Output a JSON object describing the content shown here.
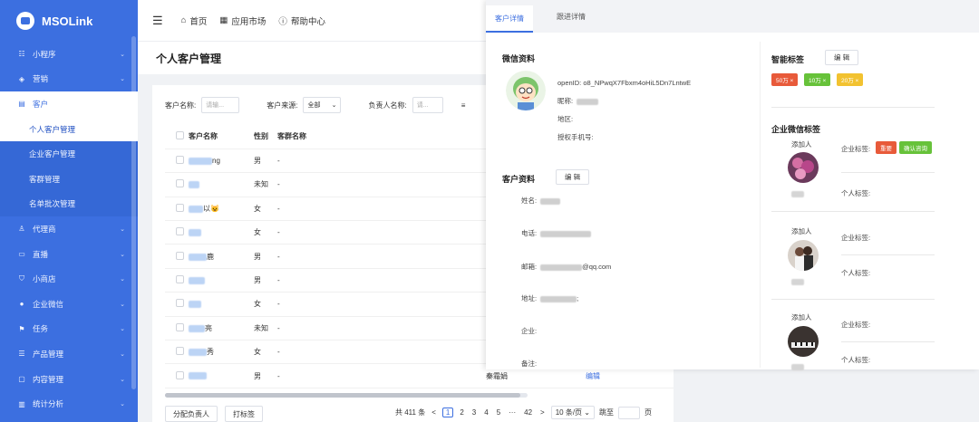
{
  "app": {
    "logo_text": "MSOLink"
  },
  "sidebar": {
    "items": [
      {
        "label": "小程序",
        "icon": "list-icon"
      },
      {
        "label": "营销",
        "icon": "megaphone-icon"
      },
      {
        "label": "客户",
        "icon": "document-icon"
      },
      {
        "label": "代理商",
        "icon": "user-icon"
      },
      {
        "label": "直播",
        "icon": "video-icon"
      },
      {
        "label": "小商店",
        "icon": "cart-icon"
      },
      {
        "label": "企业微信",
        "icon": "wechat-icon"
      },
      {
        "label": "任务",
        "icon": "flag-icon"
      },
      {
        "label": "产品管理",
        "icon": "list-icon"
      },
      {
        "label": "内容管理",
        "icon": "file-icon"
      },
      {
        "label": "统计分析",
        "icon": "chart-icon"
      }
    ],
    "sub_items": [
      {
        "label": "个人客户管理"
      },
      {
        "label": "企业客户管理"
      },
      {
        "label": "客群管理"
      },
      {
        "label": "名单批次管理"
      }
    ]
  },
  "topbar": {
    "home": "首页",
    "market": "应用市场",
    "help": "帮助中心"
  },
  "page": {
    "title": "个人客户管理"
  },
  "filters": {
    "name_label": "客户名称:",
    "name_placeholder": "请输...",
    "source_label": "客户来源:",
    "source_value": "全部",
    "owner_label": "负责人名称:",
    "owner_placeholder": "请...",
    "more": "≡"
  },
  "table": {
    "headers": {
      "name": "客户名称",
      "gender": "性别",
      "wechat": "客群名称"
    },
    "rows": [
      {
        "suffix": "ng",
        "gender": "男",
        "wechat": "-"
      },
      {
        "suffix": "",
        "gender": "未知",
        "wechat": "-"
      },
      {
        "suffix": "以😺",
        "gender": "女",
        "wechat": "-"
      },
      {
        "suffix": "",
        "gender": "女",
        "wechat": "-"
      },
      {
        "suffix": "鹿",
        "gender": "男",
        "wechat": "-"
      },
      {
        "suffix": "",
        "gender": "男",
        "wechat": "-"
      },
      {
        "suffix": "",
        "gender": "女",
        "wechat": "-"
      },
      {
        "suffix": "亮",
        "gender": "未知",
        "wechat": "-"
      },
      {
        "suffix": "秀",
        "gender": "女",
        "wechat": "-"
      },
      {
        "suffix": "",
        "gender": "男",
        "wechat": "-",
        "extra": "秦霜娟",
        "action": "编辑"
      }
    ]
  },
  "footer": {
    "assign_btn": "分配负责人",
    "tag_btn": "打标签",
    "total": "共 411 条",
    "prev": "<",
    "pages": [
      "1",
      "2",
      "3",
      "4",
      "5",
      "···",
      "42"
    ],
    "next": ">",
    "page_size": "10 条/页",
    "jump": "跳至",
    "page_unit": "页"
  },
  "drawer": {
    "tabs": [
      "客户详情",
      "跟进详情"
    ],
    "wechat_profile": {
      "title": "微信资料",
      "openid_label": "openID:",
      "openid": "o8_NPwqX7Fbxm4oHiL5Dn7LntwE",
      "nickname_label": "昵称:",
      "region_label": "地区:",
      "phone_label": "授权手机号:"
    },
    "customer_profile": {
      "title": "客户资料",
      "edit": "编 辑",
      "name_label": "姓名:",
      "phone_label": "电话:",
      "email_label": "邮箱:",
      "email_suffix": "@qq.com",
      "address_label": "地址:",
      "address_suffix": ";",
      "company_label": "企业:",
      "remark_label": "备注:"
    },
    "smart_tags": {
      "title": "智能标签",
      "edit": "编 辑",
      "tags": [
        {
          "label": "50万 ×",
          "color": "#e85a3a"
        },
        {
          "label": "10万 ×",
          "color": "#67c23a"
        },
        {
          "label": "20万 ×",
          "color": "#f2c230"
        }
      ]
    },
    "wecom_tags": {
      "title": "企业微信标签",
      "adders": [
        {
          "adder_label": "添加人",
          "company_tag_label": "企业标签:",
          "personal_tag_label": "个人标签:",
          "tags": [
            {
              "label": "重要",
              "color": "#e85a3a"
            },
            {
              "label": "确认咨询",
              "color": "#67c23a"
            }
          ]
        },
        {
          "adder_label": "添加人",
          "company_tag_label": "企业标签:",
          "personal_tag_label": "个人标签:",
          "tags": []
        },
        {
          "adder_label": "添加人",
          "company_tag_label": "企业标签:",
          "personal_tag_label": "个人标签:",
          "tags": []
        }
      ]
    }
  }
}
